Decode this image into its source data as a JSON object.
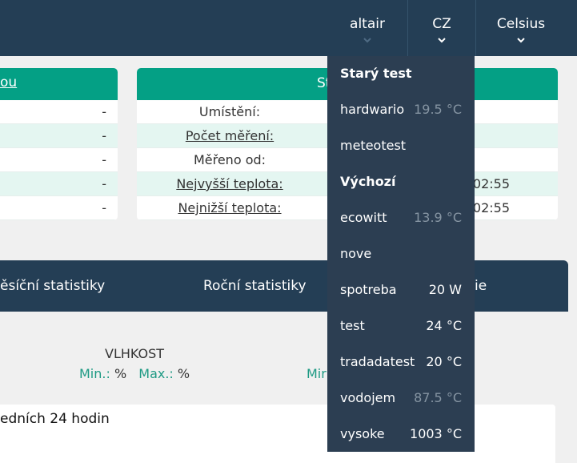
{
  "nav": {
    "station": "altair",
    "language": "CZ",
    "unit": "Celsius"
  },
  "left_card": {
    "header_link": "ou",
    "values": [
      "-",
      "-",
      "-",
      "-",
      "-"
    ]
  },
  "right_card": {
    "header_fragment": "St",
    "rows": [
      {
        "label": "Umístění:",
        "value": ""
      },
      {
        "label": "Počet měření:",
        "value": ""
      },
      {
        "label": "Měřeno od:",
        "value": ""
      },
      {
        "label": "Nejvyšší teplota:",
        "value": "02:55"
      },
      {
        "label": "Nejnižší teplota:",
        "value": "02:55"
      }
    ]
  },
  "tabs": {
    "monthly": "ěsíční statistiky",
    "yearly": "Roční statistiky",
    "other": "ie"
  },
  "stats": {
    "humidity_title": "VLHKOST",
    "min_label": "Min.:",
    "min_value": "%",
    "max_label": "Max.:",
    "max_value": "%",
    "right_min_label": "Mir"
  },
  "chart": {
    "title": "edních 24 hodin"
  },
  "dropdown": {
    "group1": "Starý test",
    "group2": "Výchozí",
    "items": [
      {
        "name": "hardwario",
        "value": "19.5 °C",
        "dim": true
      },
      {
        "name": "meteotest",
        "value": "",
        "dim": false
      },
      {
        "name": "ecowitt",
        "value": "13.9 °C",
        "dim": true
      },
      {
        "name": "nove",
        "value": "",
        "dim": false
      },
      {
        "name": "spotreba",
        "value": "20 W",
        "dim": false
      },
      {
        "name": "test",
        "value": "24 °C",
        "dim": false
      },
      {
        "name": "tradadatest",
        "value": "20 °C",
        "dim": false
      },
      {
        "name": "vodojem",
        "value": "87.5 °C",
        "dim": true
      },
      {
        "name": "vysoke",
        "value": "1003 °C",
        "dim": false
      }
    ]
  }
}
